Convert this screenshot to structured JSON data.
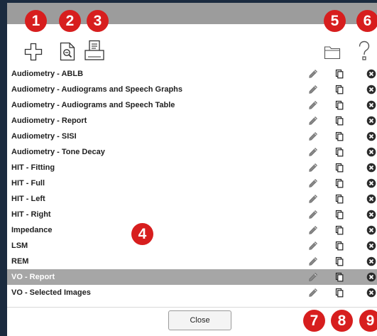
{
  "toolbar": {
    "add_icon": "plus-outline-icon",
    "preview_icon": "document-zoom-icon",
    "print_icon": "printer-icon",
    "folder_icon": "folder-icon",
    "help_icon": "question-mark-icon"
  },
  "templates": [
    {
      "label": "Audiometry - ABLB"
    },
    {
      "label": "Audiometry - Audiograms and Speech Graphs"
    },
    {
      "label": "Audiometry - Audiograms and Speech Table"
    },
    {
      "label": "Audiometry - Report"
    },
    {
      "label": "Audiometry - SISI"
    },
    {
      "label": "Audiometry - Tone Decay"
    },
    {
      "label": "HIT - Fitting"
    },
    {
      "label": "HIT - Full"
    },
    {
      "label": "HIT - Left"
    },
    {
      "label": "HIT - Right"
    },
    {
      "label": "Impedance"
    },
    {
      "label": "LSM"
    },
    {
      "label": "REM"
    },
    {
      "label": "VO - Report",
      "selected": true
    },
    {
      "label": "VO - Selected Images"
    }
  ],
  "footer": {
    "close_label": "Close"
  },
  "callouts": {
    "c1": "1",
    "c2": "2",
    "c3": "3",
    "c4": "4",
    "c5": "5",
    "c6": "6",
    "c7": "7",
    "c8": "8",
    "c9": "9"
  },
  "colors": {
    "callout": "#d71e1e",
    "titlebar": "#9c9c9c",
    "selected_row": "#a6a6a6",
    "frame": "#1b2b3f"
  }
}
